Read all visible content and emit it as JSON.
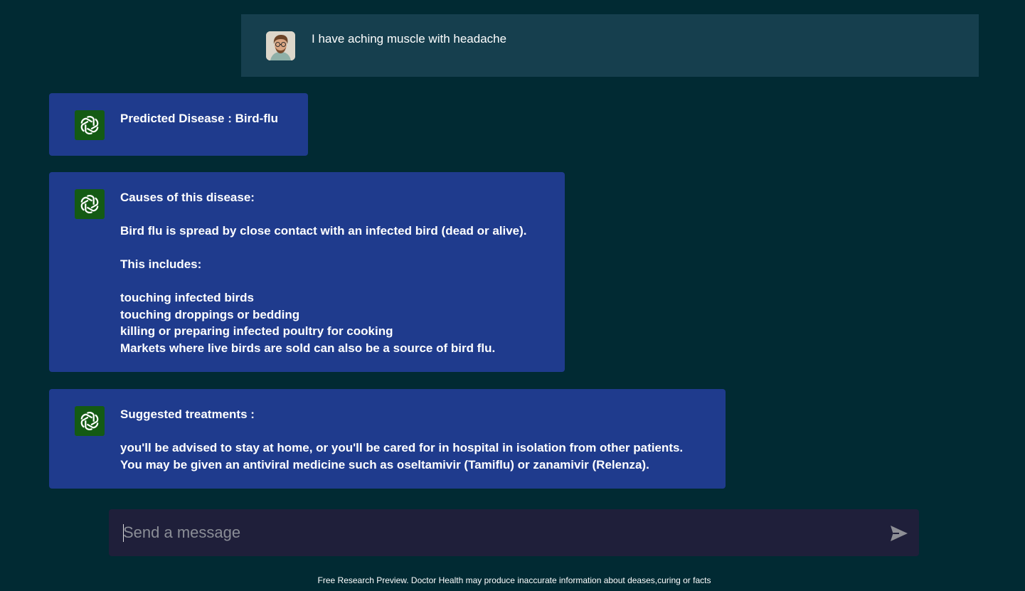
{
  "user_message": {
    "text": "I have aching muscle with headache",
    "avatar_icon": "user-avatar-photo"
  },
  "bot_messages": [
    {
      "icon": "openai-logo-icon",
      "text": "Predicted Disease : Bird-flu"
    },
    {
      "icon": "openai-logo-icon",
      "text": "Causes of this disease:\n\nBird flu is spread by close contact with an infected bird (dead or alive).\n\nThis includes:\n\ntouching infected birds\ntouching droppings or bedding\nkilling or preparing infected poultry for cooking\nMarkets where live birds are sold can also be a source of bird flu."
    },
    {
      "icon": "openai-logo-icon",
      "text": "Suggested treatments :\n\nyou'll be advised to stay at home, or you'll be cared for in hospital in isolation from other patients.\nYou may be given an antiviral medicine such as oseltamivir (Tamiflu) or zanamivir (Relenza)."
    }
  ],
  "composer": {
    "placeholder": "Send a message",
    "value": "",
    "send_icon": "send-icon"
  },
  "footer": {
    "text": "Free Research Preview. Doctor Health may produce inaccurate information about deases,curing or facts"
  },
  "colors": {
    "background": "#012a33",
    "user_bubble": "#163f4e",
    "bot_bubble": "#1f3b8d",
    "bot_icon_bg": "#145a14",
    "composer_bg": "#1f1f3a"
  }
}
